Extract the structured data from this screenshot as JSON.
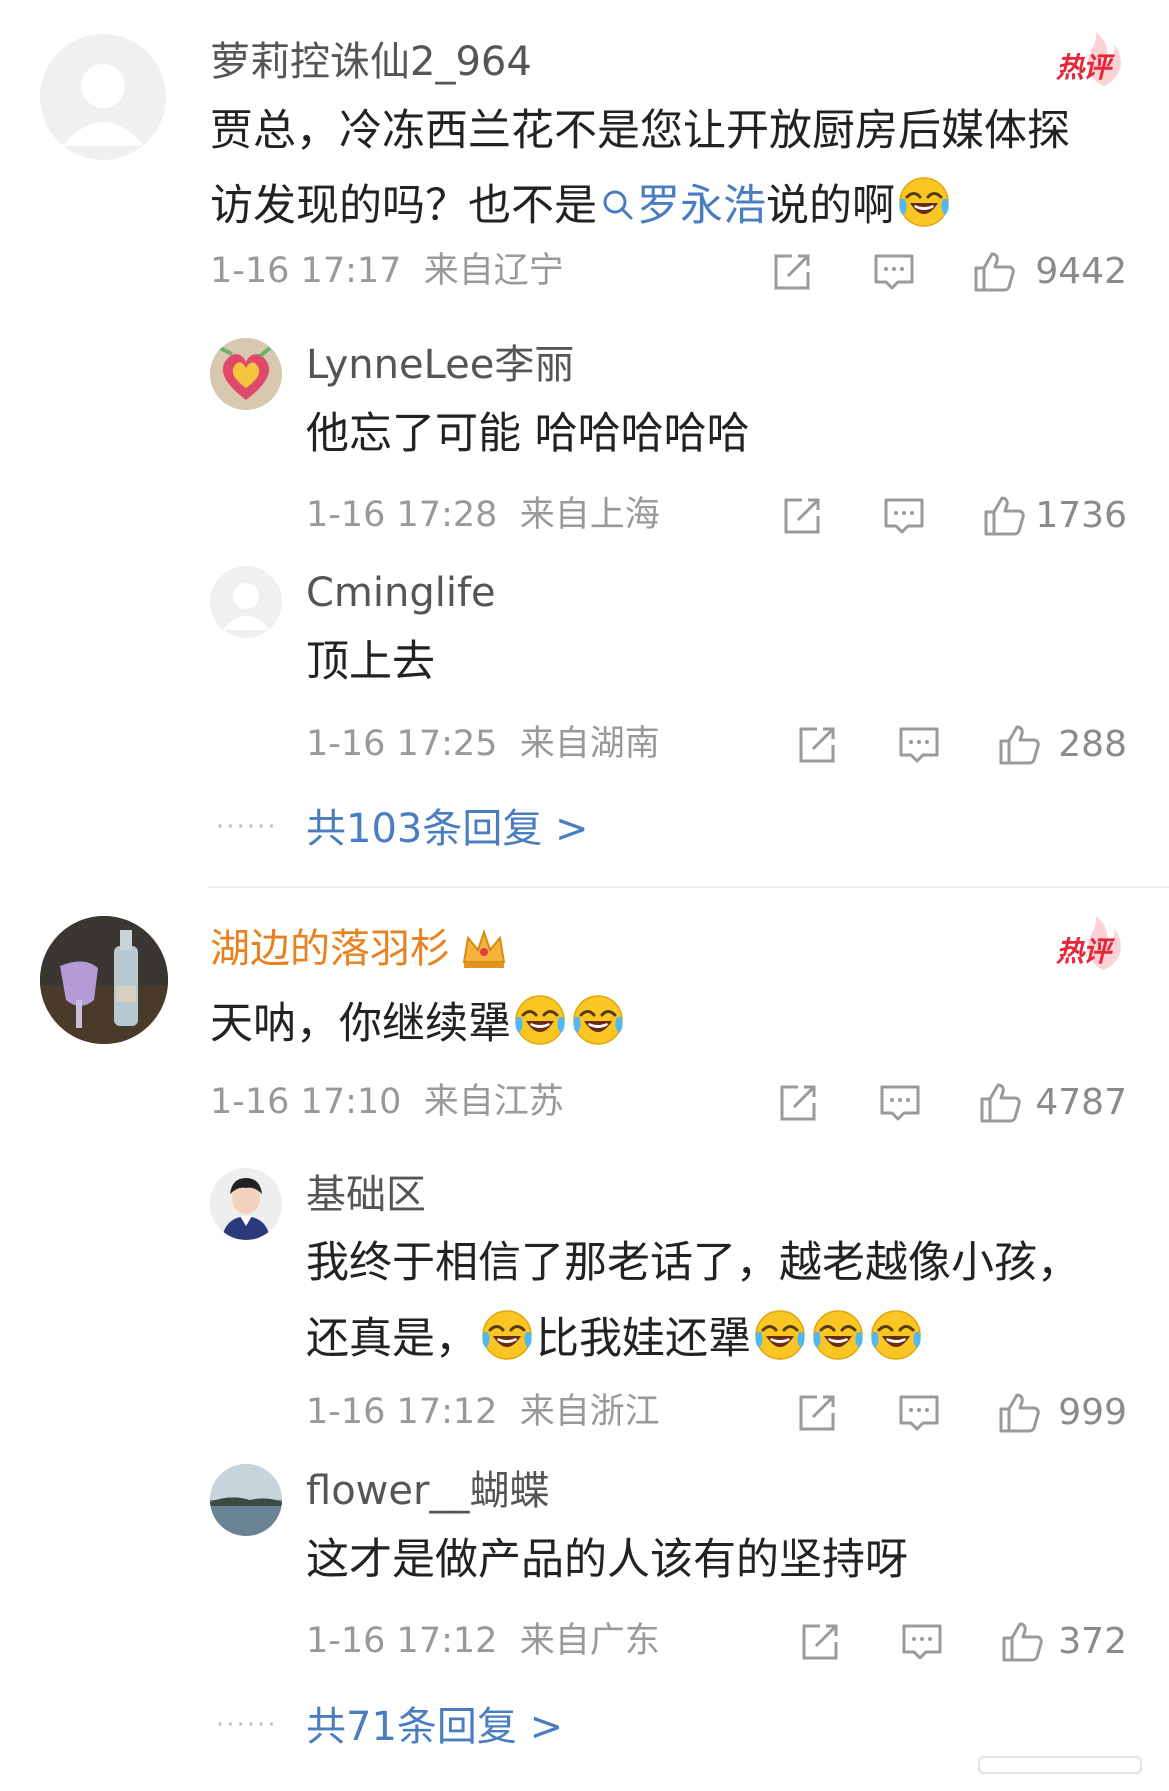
{
  "colors": {
    "name_gray": "#555555",
    "name_orange": "#e8811f",
    "link_blue": "#4a7dc0",
    "hot_red": "#e6273b",
    "meta_gray": "#999999"
  },
  "icons": {
    "share": "share-icon",
    "comment": "comment-icon",
    "like": "thumbs-up-icon",
    "hot_badge": "hot-comment-badge",
    "crown": "crown-icon",
    "laugh": "laughing-tears-emoji",
    "search": "search-icon"
  },
  "comments": [
    {
      "username": "萝莉控诛仙2_964",
      "hot_label": "热评",
      "text_line1": "贾总，冷冻西兰花不是您让开放厨房后媒体探",
      "text_line2_a": "访发现的吗？也不是",
      "mention": "罗永浩",
      "text_line2_b": "说的啊",
      "time": "1-16 17:17",
      "location": "来自辽宁",
      "likes": "9442",
      "replies": [
        {
          "username": "LynneLee李丽",
          "text": "他忘了可能 哈哈哈哈哈",
          "time": "1-16 17:28",
          "location": "来自上海",
          "likes": "1736"
        },
        {
          "username": "Cminglife",
          "text": "顶上去",
          "time": "1-16 17:25",
          "location": "来自湖南",
          "likes": "288"
        }
      ],
      "more_replies": "共103条回复 >"
    },
    {
      "username": "湖边的落羽杉",
      "hot_label": "热评",
      "text": "天呐，你继续犟",
      "time": "1-16 17:10",
      "location": "来自江苏",
      "likes": "4787",
      "replies": [
        {
          "username": "基础区",
          "text_line1": "我终于相信了那老话了，越老越像小孩，",
          "text_line2_a": "还真是，",
          "text_line2_b": "比我娃还犟",
          "time": "1-16 17:12",
          "location": "来自浙江",
          "likes": "999"
        },
        {
          "username": "flower__蝴蝶",
          "text": "这才是做产品的人该有的坚持呀",
          "time": "1-16 17:12",
          "location": "来自广东",
          "likes": "372"
        }
      ],
      "more_replies": "共71条回复 >"
    }
  ],
  "dots": "······"
}
